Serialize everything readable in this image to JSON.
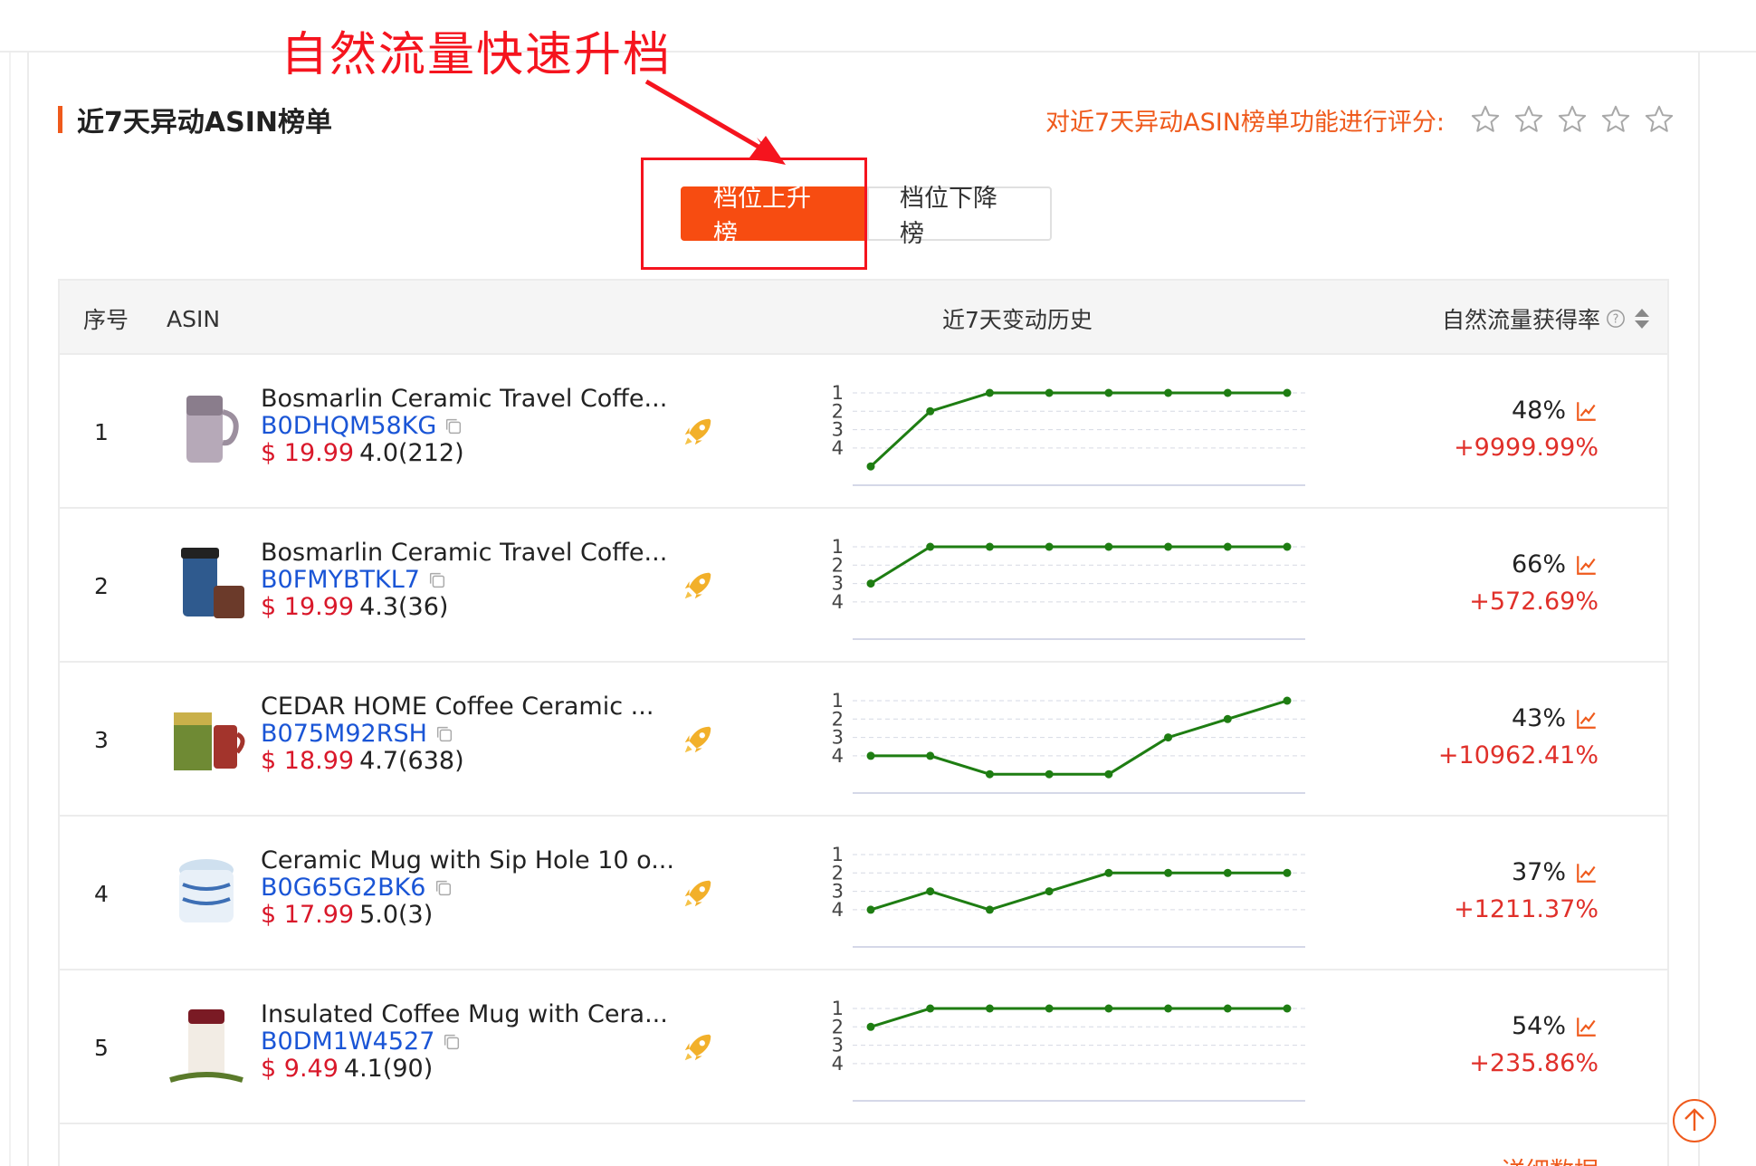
{
  "annotation": {
    "title": "自然流量快速升档"
  },
  "section": {
    "title": "近7天异动ASIN榜单",
    "rate_prompt": "对近7天异动ASIN榜单功能进行评分:",
    "stars": 5
  },
  "toggle": {
    "active_label": "档位上升榜",
    "inactive_label": "档位下降榜"
  },
  "table": {
    "headers": {
      "seq": "序号",
      "asin": "ASIN",
      "history": "近7天变动历史",
      "rate": "自然流量获得率"
    },
    "chart_axis_ticks": [
      "1",
      "2",
      "3",
      "4"
    ],
    "rows": [
      {
        "seq": "1",
        "title": "Bosmarlin Ceramic Travel Coffe...",
        "asin": "B0DHQM58KG",
        "price": "$ 19.99",
        "rating": "4.0(212)",
        "rate": "48%",
        "delta": "+9999.99%",
        "history": [
          5,
          2,
          1,
          1,
          1,
          1,
          1,
          1
        ]
      },
      {
        "seq": "2",
        "title": "Bosmarlin Ceramic Travel Coffe...",
        "asin": "B0FMYBTKL7",
        "price": "$ 19.99",
        "rating": "4.3(36)",
        "rate": "66%",
        "delta": "+572.69%",
        "history": [
          3,
          1,
          1,
          1,
          1,
          1,
          1,
          1
        ]
      },
      {
        "seq": "3",
        "title": "CEDAR HOME Coffee Ceramic ...",
        "asin": "B075M92RSH",
        "price": "$ 18.99",
        "rating": "4.7(638)",
        "rate": "43%",
        "delta": "+10962.41%",
        "history": [
          4,
          4,
          5,
          5,
          5,
          3,
          2,
          1
        ]
      },
      {
        "seq": "4",
        "title": "Ceramic Mug with Sip Hole 10 o...",
        "asin": "B0G65G2BK6",
        "price": "$ 17.99",
        "rating": "5.0(3)",
        "rate": "37%",
        "delta": "+1211.37%",
        "history": [
          4,
          3,
          4,
          3,
          2,
          2,
          2,
          2
        ]
      },
      {
        "seq": "5",
        "title": "Insulated Coffee Mug with Cera...",
        "asin": "B0DM1W4527",
        "price": "$ 9.49",
        "rating": "4.1(90)",
        "rate": "54%",
        "delta": "+235.86%",
        "history": [
          2,
          1,
          1,
          1,
          1,
          1,
          1,
          1
        ]
      }
    ]
  },
  "footer": {
    "detail_link": "详细数据"
  },
  "colors": {
    "accent": "#f74c11",
    "line": "#1e7d12",
    "asin_link": "#1a55d6",
    "price": "#d9182a",
    "annotation": "#f5141e"
  }
}
